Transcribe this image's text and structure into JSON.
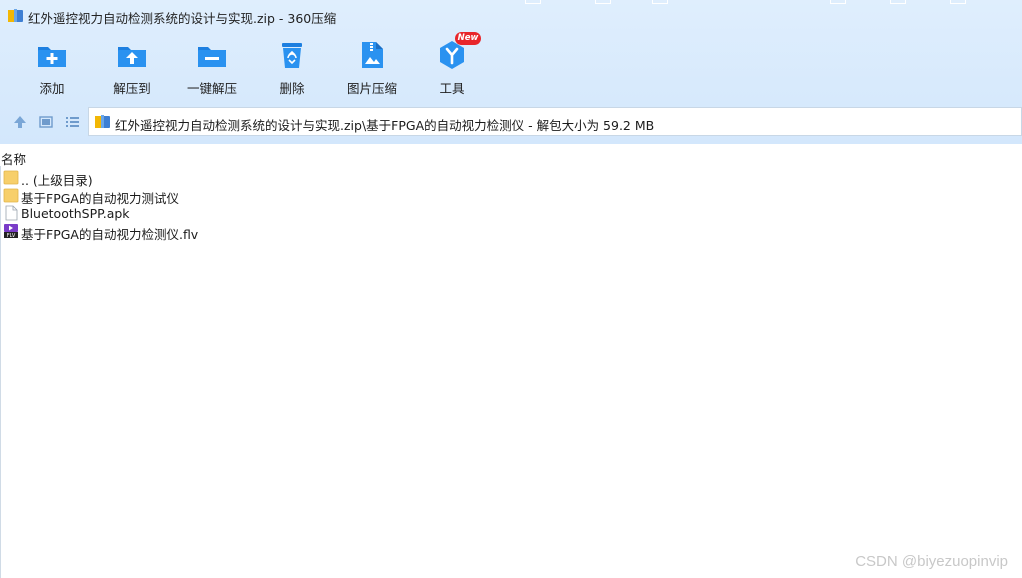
{
  "window": {
    "title": "红外遥控视力自动检测系统的设计与实现.zip - 360压缩"
  },
  "toolbar": {
    "items": [
      {
        "label": "添加",
        "icon": "add-folder-icon"
      },
      {
        "label": "解压到",
        "icon": "extract-to-icon"
      },
      {
        "label": "一键解压",
        "icon": "one-click-extract-icon"
      },
      {
        "label": "删除",
        "icon": "recycle-bin-icon"
      },
      {
        "label": "图片压缩",
        "icon": "image-compress-icon"
      },
      {
        "label": "工具",
        "icon": "tools-icon"
      }
    ],
    "new_badge": "New"
  },
  "address": {
    "path": "红外遥控视力自动检测系统的设计与实现.zip\\基于FPGA的自动视力检测仪 - 解包大小为 59.2 MB"
  },
  "columns": {
    "name": "名称"
  },
  "files": [
    {
      "name": ".. (上级目录)",
      "icon": "folder-icon"
    },
    {
      "name": "基于FPGA的自动视力测试仪",
      "icon": "folder-icon"
    },
    {
      "name": "BluetoothSPP.apk",
      "icon": "file-icon"
    },
    {
      "name": "基于FPGA的自动视力检测仪.flv",
      "icon": "flv-video-icon"
    }
  ],
  "watermark": "CSDN @biyezuopinvip",
  "colors": {
    "accent": "#1a86e0",
    "band": "#d9eafc",
    "badge": "#e8262b"
  }
}
